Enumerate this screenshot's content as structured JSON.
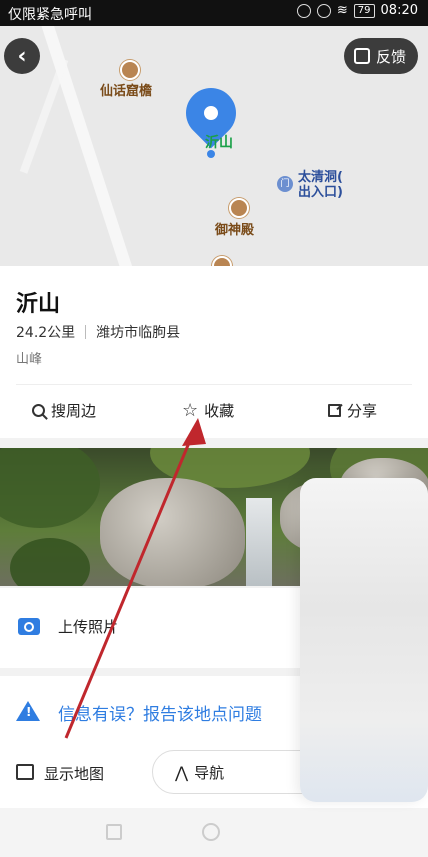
{
  "status_bar": {
    "carrier": "仅限紧急呼叫",
    "battery": "79",
    "time": "08:20"
  },
  "map": {
    "feedback_label": "反馈",
    "pois": [
      {
        "name": "仙话窟檐"
      },
      {
        "name": "御神殿"
      }
    ],
    "selected_name": "沂山",
    "gate_label_line1": "太清洞(",
    "gate_label_line2": "出入口)"
  },
  "place": {
    "name": "沂山",
    "distance": "24.2公里",
    "region": "潍坊市临朐县",
    "category": "山峰"
  },
  "actions": {
    "nearby": "搜周边",
    "favorite": "收藏",
    "share": "分享"
  },
  "upload_label": "上传照片",
  "report_label": "信息有误？报告该地点问题",
  "bottom": {
    "show_map": "显示地图",
    "navigate": "导航"
  },
  "colors": {
    "accent": "#2f7de1",
    "pin": "#3b85e6",
    "annotation": "#c0272d"
  }
}
